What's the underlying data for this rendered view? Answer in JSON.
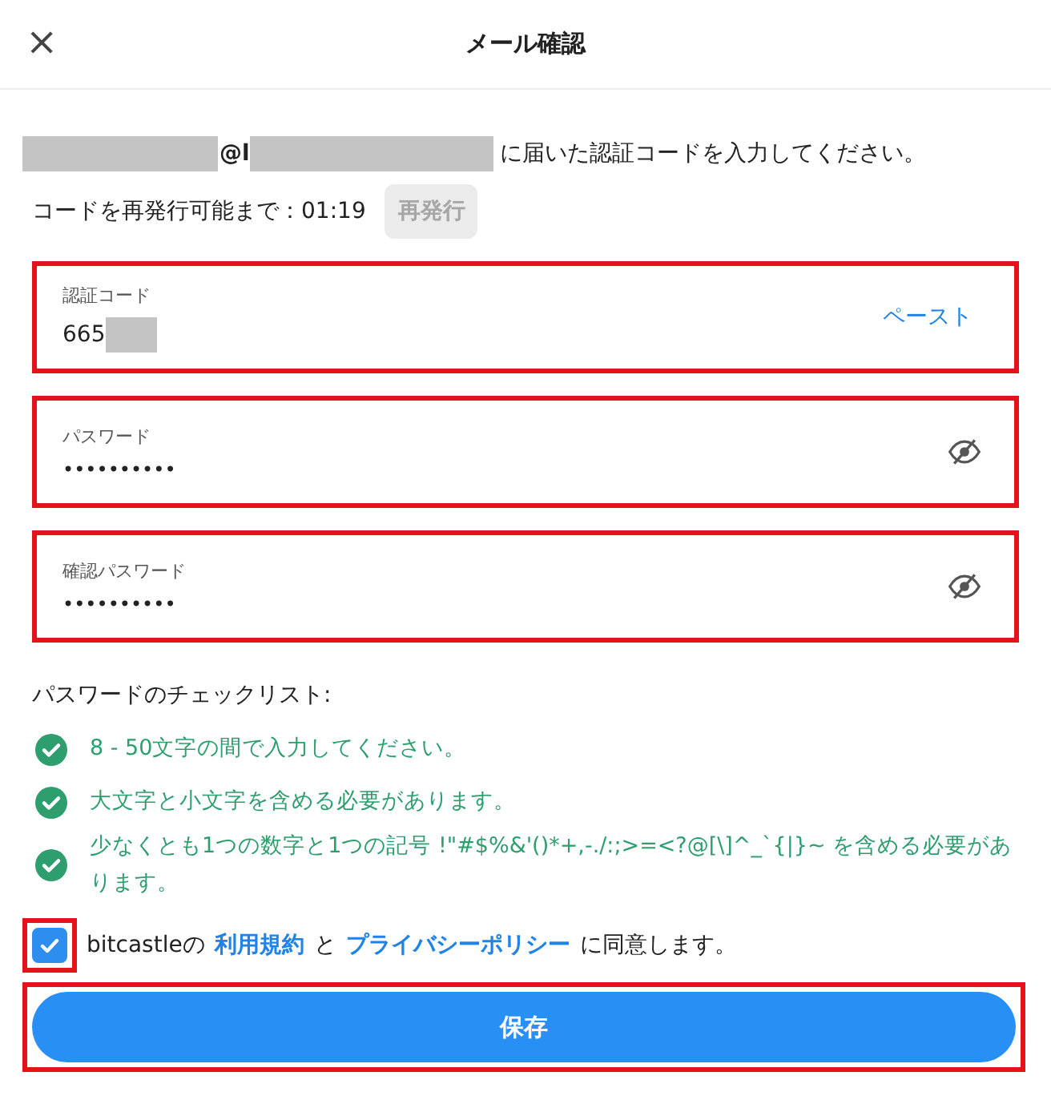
{
  "header": {
    "close_icon": "×",
    "title": "メール確認"
  },
  "intro": {
    "email_visible": "@l",
    "message": "に届いた認証コードを入力してください。"
  },
  "resend": {
    "label": "コードを再発行可能まで：01:19",
    "button": "再発行",
    "disabled": true
  },
  "fields": [
    {
      "kind": "code",
      "label": "認証コード",
      "value": "665",
      "action": "ペースト",
      "highlighted": true
    },
    {
      "kind": "password",
      "label": "パスワード",
      "value": "••••••••••",
      "highlighted": true
    },
    {
      "kind": "password",
      "label": "確認パスワード",
      "value": "••••••••••",
      "highlighted": true
    }
  ],
  "checklist": {
    "title": "パスワードのチェックリスト:",
    "items": [
      {
        "text": "8 - 50文字の間で入力してください。",
        "checked": true
      },
      {
        "text": "大文字と小文字を含める必要があります。",
        "checked": true
      },
      {
        "text": "少なくとも1つの数字と1つの記号 !\"#$%&'()*+,-./:;>=<?@[\\]^_`{|}~ を含める必要があります。",
        "checked": true
      }
    ]
  },
  "agreement": {
    "checked": true,
    "highlighted": true,
    "prefix": "bitcastleの",
    "terms_link": "利用規約",
    "middle": "と",
    "privacy_link": "プライバシーポリシー",
    "suffix": "に同意します。"
  },
  "save_button": {
    "label": "保存",
    "highlighted": true
  }
}
